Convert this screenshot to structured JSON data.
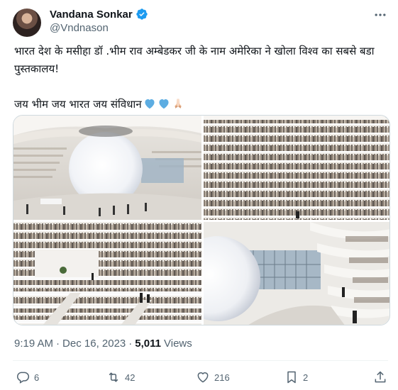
{
  "author": {
    "display_name": "Vandana Sonkar",
    "handle": "@Vndnason",
    "verified": true,
    "verified_color": "#1d9bf0"
  },
  "tweet": {
    "line1": "भारत देश के मसीहा डॉ .भीम राव अम्बेडकर जी के नाम अमेरिका ने खोला विश्व का सबसे बडा पुस्तकालय!",
    "line2": "जय भीम जय भारत जय संविधान"
  },
  "media": {
    "images": [
      {
        "icon": "library-atrium-photo"
      },
      {
        "icon": "bookshelf-wall-photo"
      },
      {
        "icon": "library-stairs-photo"
      },
      {
        "icon": "library-sphere-photo"
      }
    ]
  },
  "meta": {
    "time": "9:19 AM",
    "separator": "·",
    "date": "Dec 16, 2023",
    "separator2": "·",
    "views_count": "5,011",
    "views_label": "Views"
  },
  "actions": {
    "replies": "6",
    "retweets": "42",
    "likes": "216",
    "bookmarks": "2"
  },
  "colors": {
    "text": "#0f1419",
    "secondary": "#536471",
    "heart_emoji": "#5dade2"
  }
}
